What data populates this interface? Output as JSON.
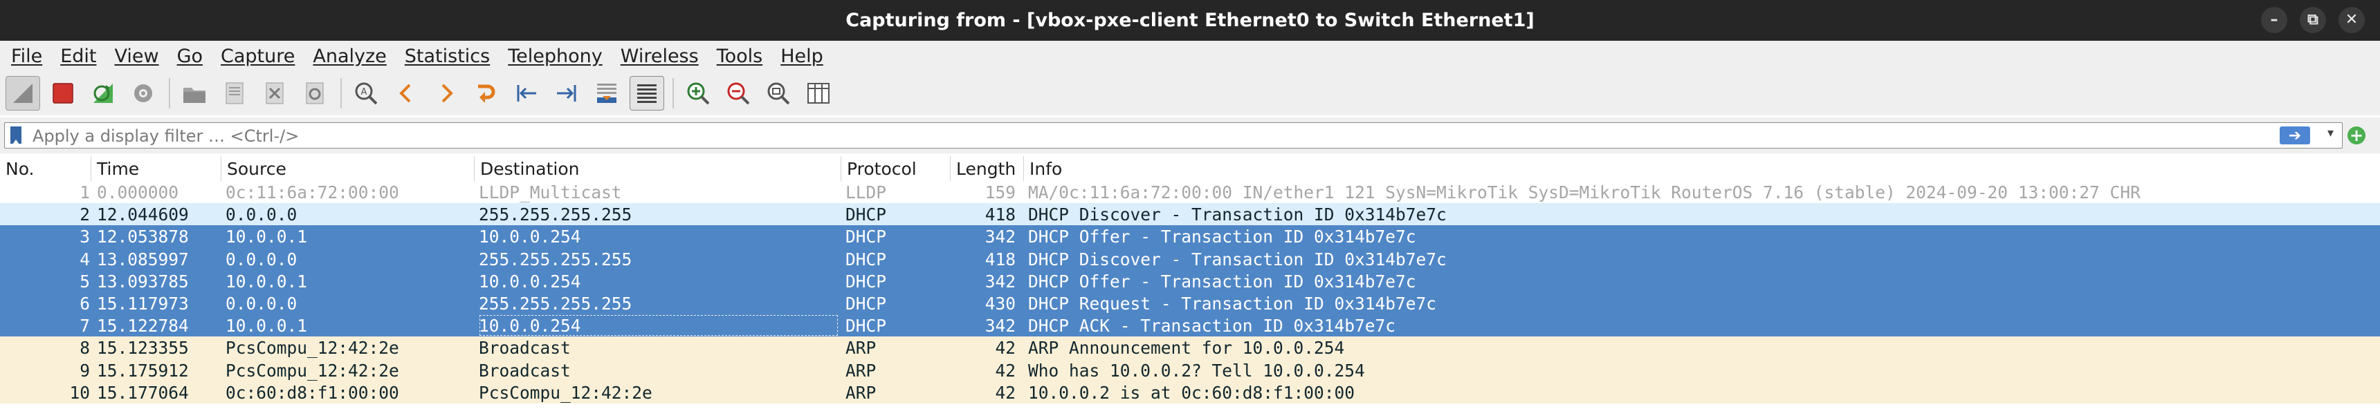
{
  "window": {
    "title": "Capturing from - [vbox-pxe-client Ethernet0 to Switch Ethernet1]",
    "controls": [
      "minimize-icon",
      "restore-icon",
      "close-icon"
    ]
  },
  "menu": [
    "File",
    "Edit",
    "View",
    "Go",
    "Capture",
    "Analyze",
    "Statistics",
    "Telephony",
    "Wireless",
    "Tools",
    "Help"
  ],
  "toolbar": {
    "icons": [
      "start-capture-icon",
      "stop-capture-icon",
      "restart-capture-icon",
      "capture-options-icon",
      "open-file-icon",
      "save-file-icon",
      "close-file-icon",
      "reload-icon",
      "find-packet-icon",
      "go-back-icon",
      "go-forward-icon",
      "go-to-packet-icon",
      "first-packet-icon",
      "last-packet-icon",
      "auto-scroll-icon",
      "colorize-icon",
      "zoom-in-icon",
      "zoom-out-icon",
      "normal-size-icon",
      "resize-columns-icon"
    ]
  },
  "filter": {
    "placeholder": "Apply a display filter … <Ctrl-/>",
    "value": ""
  },
  "columns": [
    "No.",
    "Time",
    "Source",
    "Destination",
    "Protocol",
    "Length",
    "Info"
  ],
  "colors": {
    "titlebar": "#262626",
    "selected_row": "#4f86c6",
    "dhcp_row": "#daeefc",
    "arp_row": "#faf0d7",
    "lldp_text": "#a6a6a6"
  },
  "packets": [
    {
      "no": "1",
      "time": "0.000000",
      "source": "0c:11:6a:72:00:00",
      "destination": "LLDP_Multicast",
      "protocol": "LLDP",
      "length": "159",
      "info": "MA/0c:11:6a:72:00:00 IN/ether1 121 SysN=MikroTik SysD=MikroTik RouterOS 7.16 (stable) 2024-09-20 13:00:27 CHR",
      "style": "lldp"
    },
    {
      "no": "2",
      "time": "12.044609",
      "source": "0.0.0.0",
      "destination": "255.255.255.255",
      "protocol": "DHCP",
      "length": "418",
      "info": "DHCP Discover - Transaction ID 0x314b7e7c",
      "style": "dhcp-light"
    },
    {
      "no": "3",
      "time": "12.053878",
      "source": "10.0.0.1",
      "destination": "10.0.0.254",
      "protocol": "DHCP",
      "length": "342",
      "info": "DHCP Offer    - Transaction ID 0x314b7e7c",
      "style": "dhcp-sel"
    },
    {
      "no": "4",
      "time": "13.085997",
      "source": "0.0.0.0",
      "destination": "255.255.255.255",
      "protocol": "DHCP",
      "length": "418",
      "info": "DHCP Discover - Transaction ID 0x314b7e7c",
      "style": "dhcp-sel"
    },
    {
      "no": "5",
      "time": "13.093785",
      "source": "10.0.0.1",
      "destination": "10.0.0.254",
      "protocol": "DHCP",
      "length": "342",
      "info": "DHCP Offer    - Transaction ID 0x314b7e7c",
      "style": "dhcp-sel"
    },
    {
      "no": "6",
      "time": "15.117973",
      "source": "0.0.0.0",
      "destination": "255.255.255.255",
      "protocol": "DHCP",
      "length": "430",
      "info": "DHCP Request  - Transaction ID 0x314b7e7c",
      "style": "dhcp-sel"
    },
    {
      "no": "7",
      "time": "15.122784",
      "source": "10.0.0.1",
      "destination": "10.0.0.254",
      "protocol": "DHCP",
      "length": "342",
      "info": "DHCP ACK      - Transaction ID 0x314b7e7c",
      "style": "dhcp-sel"
    },
    {
      "no": "8",
      "time": "15.123355",
      "source": "PcsCompu_12:42:2e",
      "destination": "Broadcast",
      "protocol": "ARP",
      "length": "42",
      "info": "ARP Announcement for 10.0.0.254",
      "style": "arp"
    },
    {
      "no": "9",
      "time": "15.175912",
      "source": "PcsCompu_12:42:2e",
      "destination": "Broadcast",
      "protocol": "ARP",
      "length": "42",
      "info": "Who has 10.0.0.2? Tell 10.0.0.254",
      "style": "arp"
    },
    {
      "no": "10",
      "time": "15.177064",
      "source": "0c:60:d8:f1:00:00",
      "destination": "PcsCompu_12:42:2e",
      "protocol": "ARP",
      "length": "42",
      "info": "10.0.0.2 is at 0c:60:d8:f1:00:00",
      "style": "arp"
    }
  ]
}
